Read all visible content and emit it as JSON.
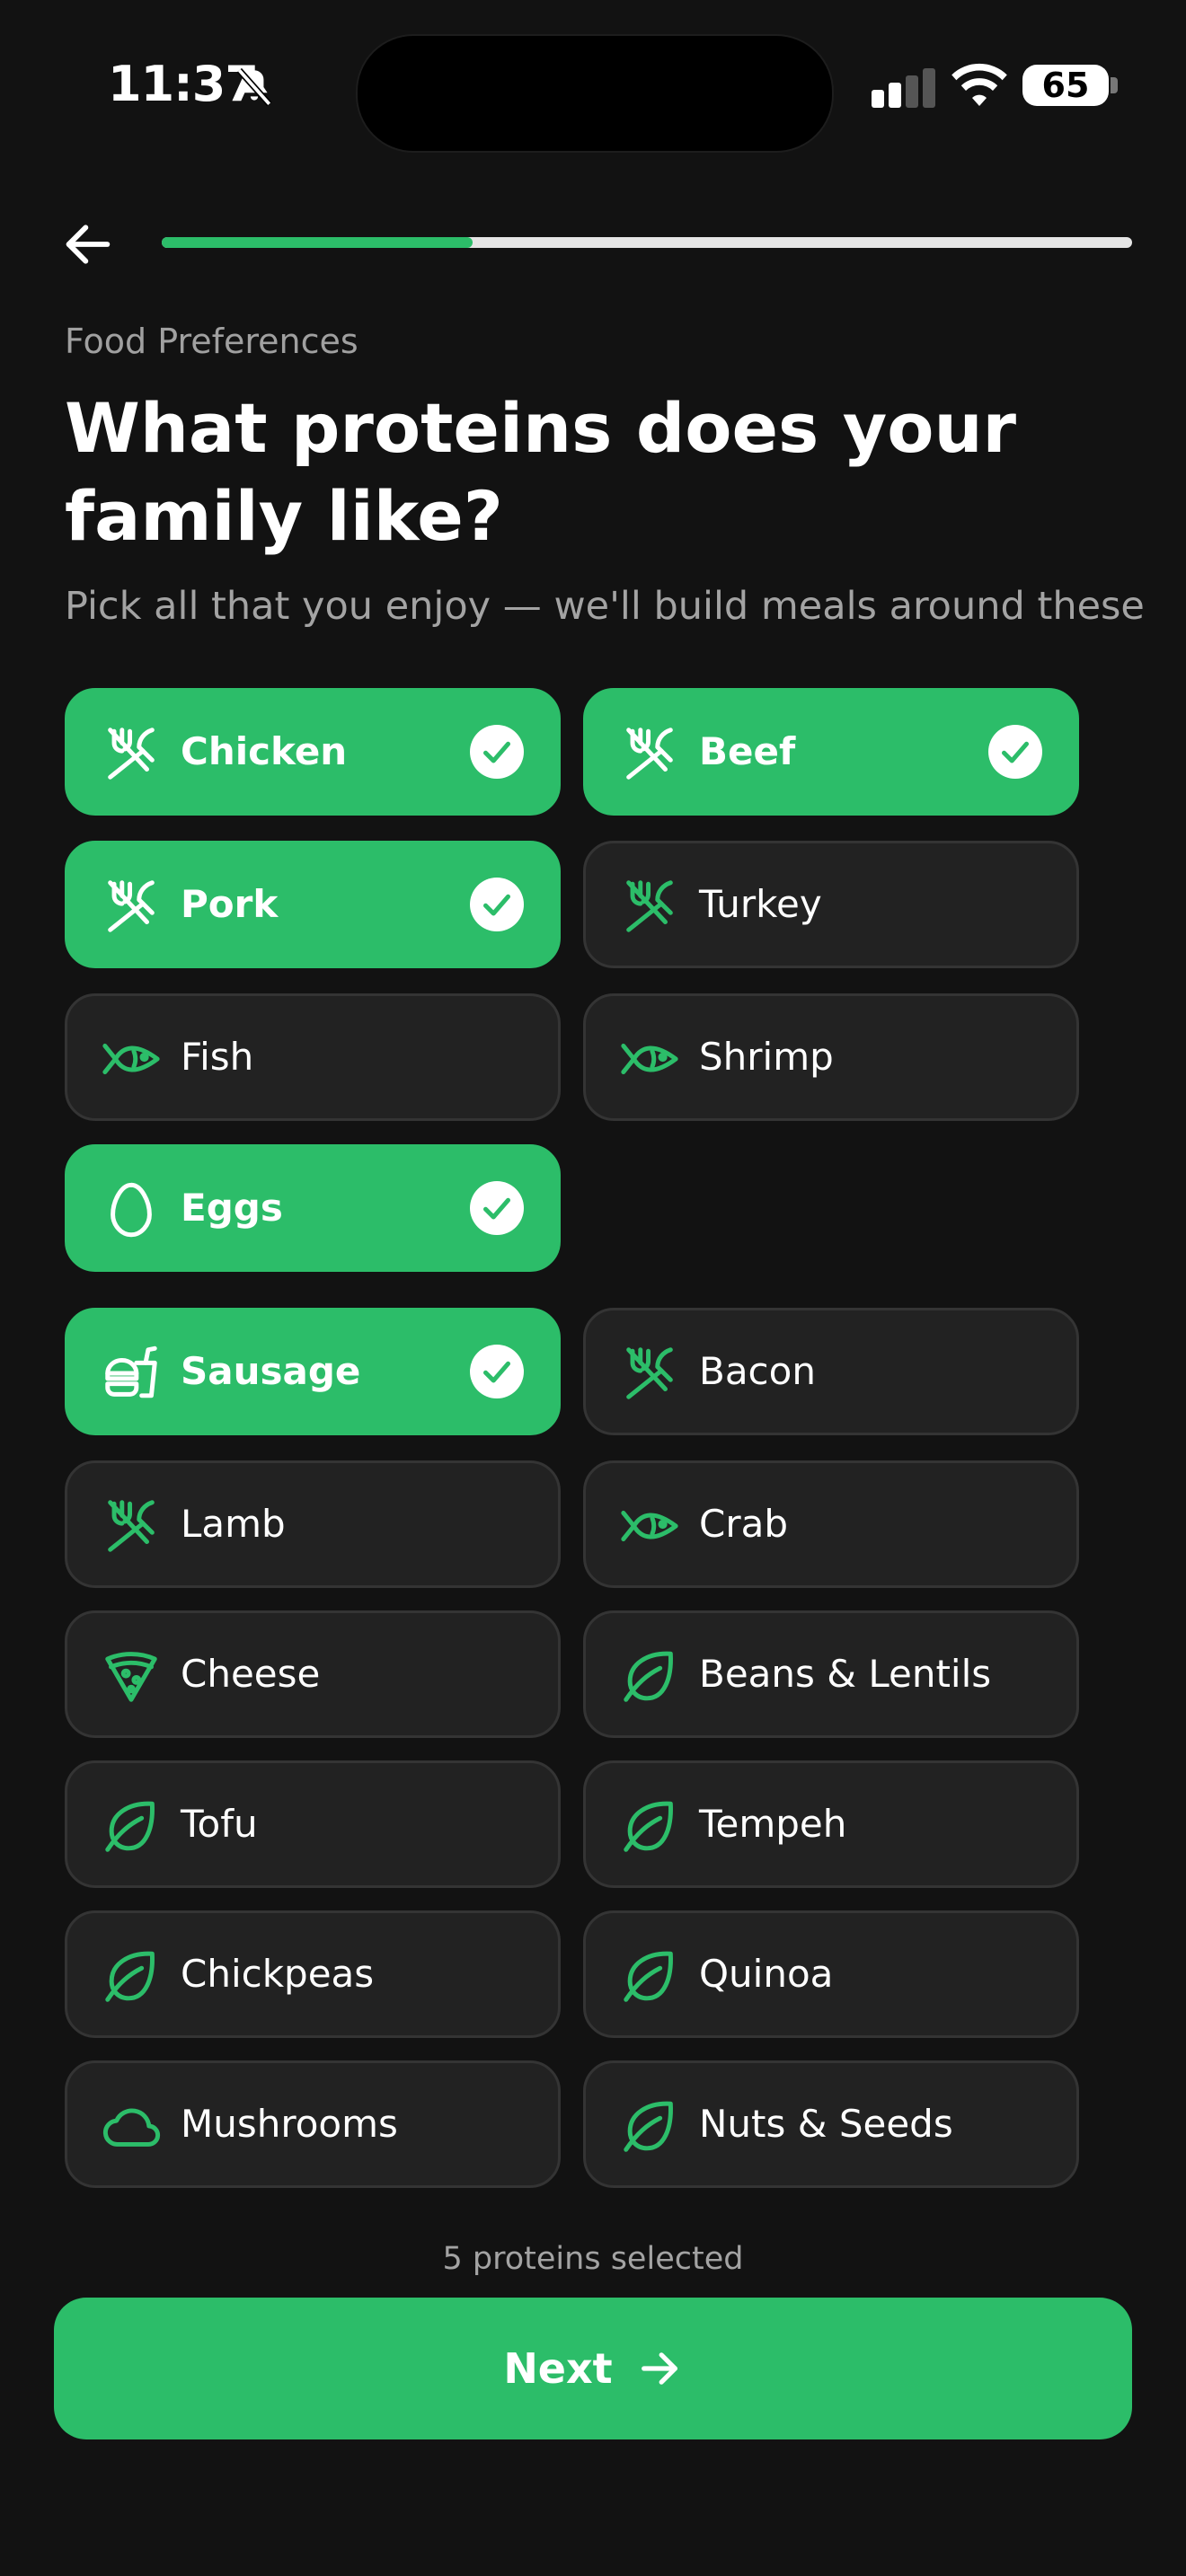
{
  "status": {
    "time": "11:37",
    "battery": "65"
  },
  "progress": {
    "fraction": 0.32
  },
  "header": {
    "eyebrow": "Food Preferences",
    "title": "What proteins does your family like?",
    "subtitle": "Pick all that you enjoy — we'll build meals around these"
  },
  "options": [
    {
      "label": "Chicken",
      "icon": "utensils-icon",
      "selected": true
    },
    {
      "label": "Beef",
      "icon": "utensils-icon",
      "selected": true
    },
    {
      "label": "Pork",
      "icon": "utensils-icon",
      "selected": true
    },
    {
      "label": "Turkey",
      "icon": "utensils-icon",
      "selected": false
    },
    {
      "label": "Fish",
      "icon": "fish-icon",
      "selected": false
    },
    {
      "label": "Shrimp",
      "icon": "fish-icon",
      "selected": false
    },
    {
      "label": "Eggs",
      "icon": "egg-icon",
      "selected": true
    },
    {
      "label": "Sausage",
      "icon": "burger-drink-icon",
      "selected": true
    },
    {
      "label": "Bacon",
      "icon": "utensils-icon",
      "selected": false
    },
    {
      "label": "Lamb",
      "icon": "utensils-icon",
      "selected": false
    },
    {
      "label": "Crab",
      "icon": "fish-icon",
      "selected": false
    },
    {
      "label": "Cheese",
      "icon": "pizza-slice-icon",
      "selected": false
    },
    {
      "label": "Beans & Lentils",
      "icon": "leaf-icon",
      "selected": false
    },
    {
      "label": "Tofu",
      "icon": "leaf-icon",
      "selected": false
    },
    {
      "label": "Tempeh",
      "icon": "leaf-icon",
      "selected": false
    },
    {
      "label": "Chickpeas",
      "icon": "leaf-icon",
      "selected": false
    },
    {
      "label": "Quinoa",
      "icon": "leaf-icon",
      "selected": false
    },
    {
      "label": "Mushrooms",
      "icon": "cloud-icon",
      "selected": false
    },
    {
      "label": "Nuts & Seeds",
      "icon": "leaf-icon",
      "selected": false
    }
  ],
  "footer": {
    "count_text": "5 proteins selected",
    "next_label": "Next"
  },
  "colors": {
    "accent": "#2cbd69",
    "background": "#121212",
    "card": "#222222"
  }
}
